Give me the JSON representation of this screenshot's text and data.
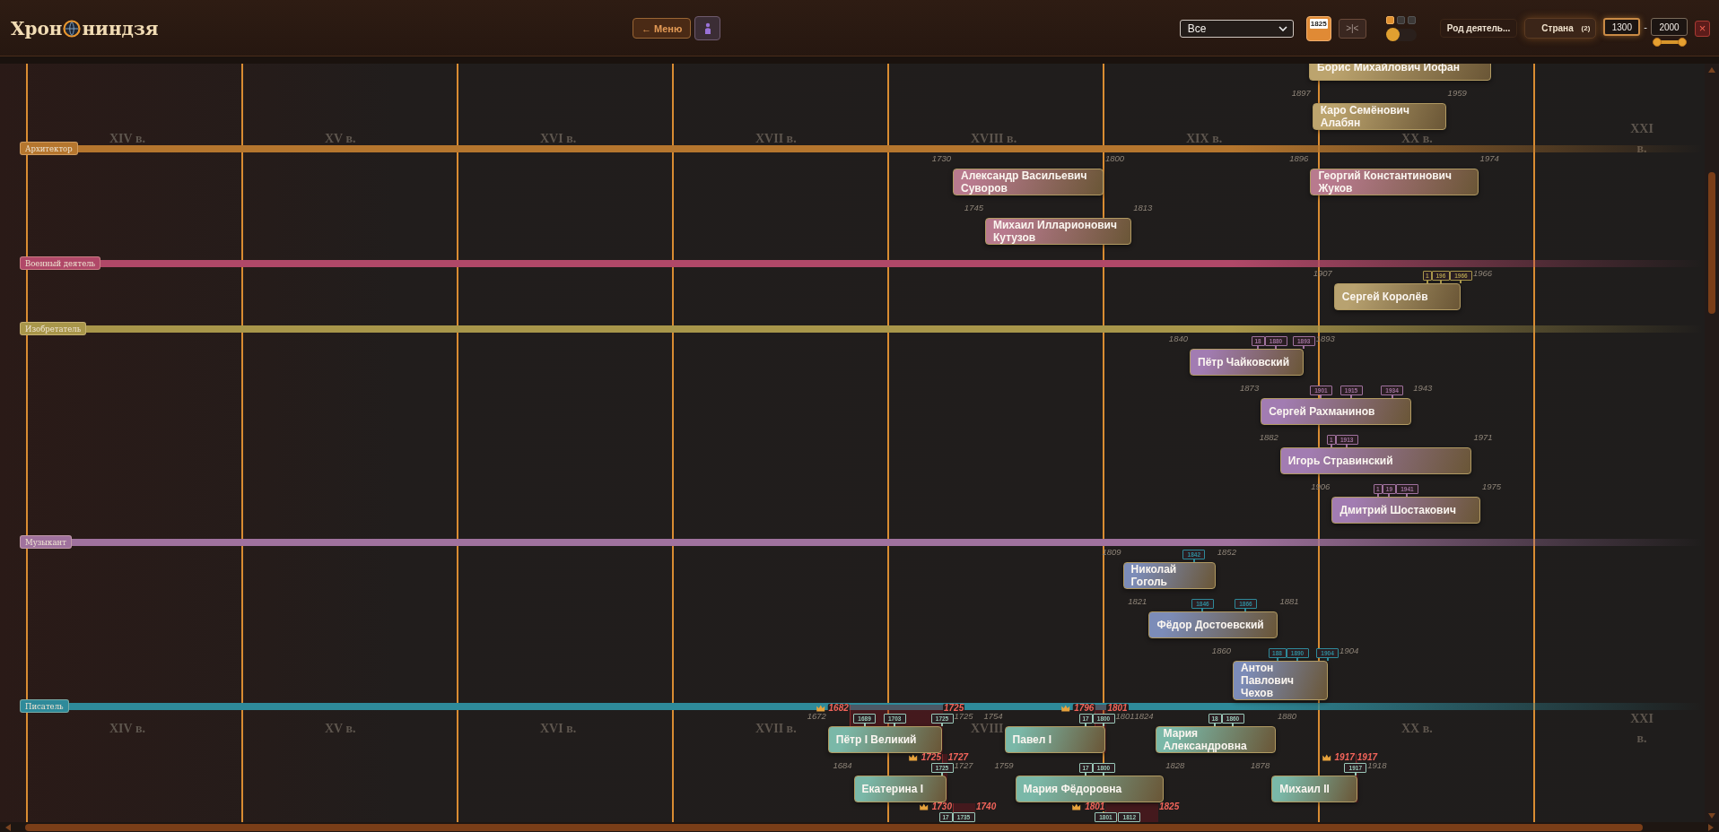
{
  "header": {
    "logo": {
      "before": "Хрон",
      "after": "ниндзя"
    },
    "menu_button": "← Меню",
    "filter": {
      "value": "Все"
    },
    "year_marker": "1825",
    "collapse_button": ">|<",
    "color_modes": [
      {
        "selected": true
      },
      {
        "selected": false
      },
      {
        "selected": false
      }
    ],
    "auto_toggle": {
      "on": false
    },
    "activity_button": "Род деятель...",
    "country_button": {
      "label": "Страна",
      "count": "(2)"
    },
    "year_from": "1300",
    "range_separator": "-",
    "year_to": "2000",
    "year_range": {
      "level": 1
    },
    "close_button": "×"
  },
  "timeline": {
    "century_bands": [
      {
        "labels": [
          {
            "label": "XIV в."
          },
          {
            "label": "XV в."
          },
          {
            "label": "XVI в."
          },
          {
            "label": "XVII в."
          },
          {
            "label": "XVIII в."
          },
          {
            "label": "XIX в."
          },
          {
            "label": "XX в."
          },
          {
            "label": "XXI в."
          }
        ]
      },
      {
        "labels": [
          {
            "label": "XIV в."
          },
          {
            "label": "XV в."
          },
          {
            "label": "XVI в."
          },
          {
            "label": "XVII в."
          },
          {
            "label": "XVIII"
          },
          {
            "label": "XX в.",
            "gap_before": true
          },
          {
            "label": "XXI в."
          }
        ]
      }
    ],
    "categories": [
      {
        "label": "Архитектор",
        "color": "#b5762e",
        "rows": [
          [
            {
              "name": "Борис Михайлович Иофан",
              "color": "#bca46e"
            }
          ],
          [
            {
              "name": "Каро Семёнович Алабян",
              "color": "#bca46e",
              "born": "1897",
              "died": "1959"
            }
          ]
        ]
      },
      {
        "label": "Военный деятель",
        "color": "#b04868",
        "rows": [
          [
            {
              "name": "Александр Васильевич Суворов",
              "color": "#b87a8e",
              "born": "1730",
              "died": "1800"
            },
            {
              "name": "Георгий Константинович Жуков",
              "color": "#b87a8e",
              "born": "1896",
              "died": "1974"
            }
          ],
          [
            {
              "name": "Михаил Илларионович Кутузов",
              "color": "#b87a8e",
              "born": "1745",
              "died": "1813"
            }
          ]
        ]
      },
      {
        "label": "Изобретатель",
        "color": "#a8964a",
        "rows": [
          [
            {
              "name": "Сергей Королёв",
              "color": "#b8a270",
              "born": "1907",
              "died": "1966",
              "events": [
                "1",
                "196",
                "1966"
              ]
            }
          ]
        ]
      },
      {
        "label": "Музыкант",
        "color": "#a0729e",
        "rows": [
          [
            {
              "name": "Пётр Чайковский",
              "color": "#a27cb2",
              "born": "1840",
              "died": "1893",
              "events": [
                "18",
                "1880",
                "1893"
              ]
            }
          ],
          [
            {
              "name": "Сергей Рахманинов",
              "color": "#a27cb2",
              "born": "1873",
              "died": "1943",
              "events": [
                "1901",
                "1915",
                "1934"
              ]
            }
          ],
          [
            {
              "name": "Игорь Стравинский",
              "color": "#a27cb2",
              "born": "1882",
              "died": "1971",
              "events": [
                "1",
                "1913"
              ]
            }
          ],
          [
            {
              "name": "Дмитрий Шостакович",
              "color": "#a27cb2",
              "born": "1906",
              "died": "1975",
              "events": [
                "1",
                "19",
                "1941"
              ]
            }
          ]
        ]
      },
      {
        "label": "Писатель",
        "color": "#2e8a9a",
        "rows": [
          [
            {
              "name": "Николай Гоголь",
              "color": "#7c8cb8",
              "born": "1809",
              "died": "1852",
              "events": [
                "1842"
              ]
            }
          ],
          [
            {
              "name": "Фёдор Достоевский",
              "color": "#7c8cb8",
              "born": "1821",
              "died": "1881",
              "events": [
                "1846",
                "1866"
              ]
            }
          ],
          [
            {
              "name": "Антон Павлович Чехов",
              "color": "#7c8cb8",
              "born": "1860",
              "died": "1904",
              "events": [
                "188",
                "1890",
                "1904"
              ]
            }
          ]
        ]
      },
      {
        "color": "#9ac8b8",
        "rows": [
          [
            {
              "name": "Пётр I Великий",
              "color": "#7ab8a8",
              "born": "1672",
              "died": "1725",
              "reign": {
                "start": "1682",
                "end": "1725"
              },
              "events": [
                "1689",
                "1703",
                "1725"
              ]
            },
            {
              "name": "Павел I",
              "color": "#7ab8a8",
              "born": "1754",
              "died": "1801",
              "reign": {
                "start": "1796",
                "end": "1801"
              },
              "events": [
                "17",
                "1800"
              ]
            },
            {
              "name": "Мария Александровна",
              "color": "#7ab8a8",
              "born": "1824",
              "died": "1880",
              "events": [
                "18",
                "1860"
              ]
            }
          ],
          [
            {
              "name": "Екатерина I",
              "color": "#7ab8a8",
              "born": "1684",
              "died": "1727",
              "reign": {
                "start": "1725",
                "end": "1727"
              },
              "events": [
                "1725"
              ]
            },
            {
              "name": "Мария Фёдоровна",
              "color": "#7ab8a8",
              "born": "1759",
              "died": "1828",
              "events": [
                "17",
                "1800"
              ]
            },
            {
              "name": "Михаил II",
              "color": "#7ab8a8",
              "born": "1878",
              "died": "1918",
              "reign": {
                "start": "1917",
                "end": "1917"
              },
              "events": [
                "1917"
              ]
            }
          ],
          [
            {
              "reign": {
                "start": "1730",
                "end": "1740"
              },
              "events": [
                "17",
                "1735"
              ]
            },
            {
              "reign": {
                "start": "1801",
                "end": "1825"
              },
              "events": [
                "1801",
                "1812"
              ]
            }
          ]
        ]
      }
    ]
  }
}
